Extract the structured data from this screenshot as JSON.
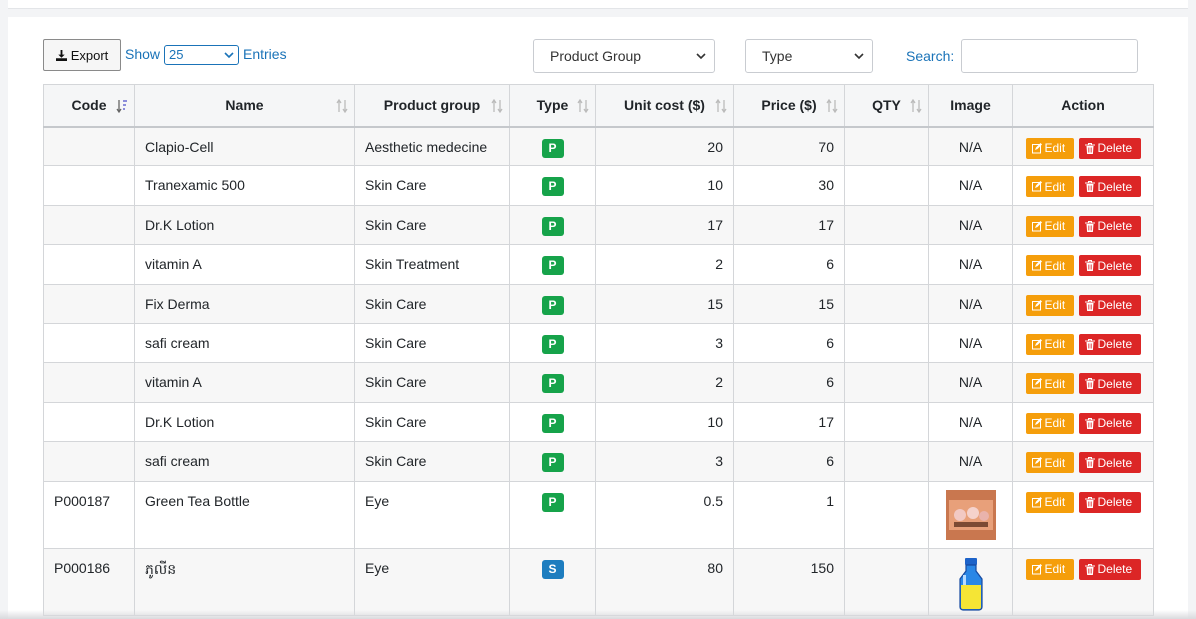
{
  "toolbar": {
    "export_label": "Export",
    "show_label": "Show",
    "entries_value": "25",
    "entries_label": "Entries",
    "product_group_select": "Product Group",
    "type_select": "Type",
    "search_label": "Search:",
    "search_value": ""
  },
  "table": {
    "headers": [
      "Code",
      "Name",
      "Product group",
      "Type",
      "Unit cost ($)",
      "Price ($)",
      "QTY",
      "Image",
      "Action"
    ],
    "edit_label": "Edit",
    "delete_label": "Delete",
    "rows": [
      {
        "code": "",
        "name": "Clapio-Cell",
        "group": "Aesthetic medecine",
        "type": "P",
        "unit_cost": "20",
        "price": "70",
        "qty": "",
        "image": "N/A"
      },
      {
        "code": "",
        "name": "Tranexamic 500",
        "group": "Skin Care",
        "type": "P",
        "unit_cost": "10",
        "price": "30",
        "qty": "",
        "image": "N/A"
      },
      {
        "code": "",
        "name": "Dr.K Lotion",
        "group": "Skin Care",
        "type": "P",
        "unit_cost": "17",
        "price": "17",
        "qty": "",
        "image": "N/A"
      },
      {
        "code": "",
        "name": "vitamin A",
        "group": "Skin Treatment",
        "type": "P",
        "unit_cost": "2",
        "price": "6",
        "qty": "",
        "image": "N/A"
      },
      {
        "code": "",
        "name": "Fix Derma",
        "group": "Skin Care",
        "type": "P",
        "unit_cost": "15",
        "price": "15",
        "qty": "",
        "image": "N/A"
      },
      {
        "code": "",
        "name": "safi cream",
        "group": "Skin Care",
        "type": "P",
        "unit_cost": "3",
        "price": "6",
        "qty": "",
        "image": "N/A"
      },
      {
        "code": "",
        "name": "vitamin A",
        "group": "Skin Care",
        "type": "P",
        "unit_cost": "2",
        "price": "6",
        "qty": "",
        "image": "N/A"
      },
      {
        "code": "",
        "name": "Dr.K Lotion",
        "group": "Skin Care",
        "type": "P",
        "unit_cost": "10",
        "price": "17",
        "qty": "",
        "image": "N/A"
      },
      {
        "code": "",
        "name": "safi cream",
        "group": "Skin Care",
        "type": "P",
        "unit_cost": "3",
        "price": "6",
        "qty": "",
        "image": "N/A"
      },
      {
        "code": "P000187",
        "name": "Green Tea Bottle",
        "group": "Eye",
        "type": "P",
        "unit_cost": "0.5",
        "price": "1",
        "qty": "",
        "image": "product-photo-icon"
      },
      {
        "code": "P000186",
        "name": "ភូលីន",
        "group": "Eye",
        "type": "S",
        "unit_cost": "80",
        "price": "150",
        "qty": "",
        "image": "bottle-icon"
      }
    ]
  },
  "colors": {
    "accent_blue": "#1a73b8",
    "badge_p": "#16a34a",
    "badge_s": "#1d7dbf",
    "edit_orange": "#f59e0b",
    "delete_red": "#dc2626"
  }
}
